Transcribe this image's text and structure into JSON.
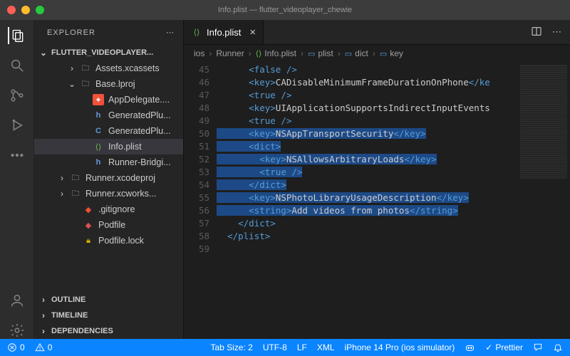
{
  "window": {
    "title": "Info.plist — flutter_videoplayer_chewie"
  },
  "sidebar": {
    "title": "EXPLORER",
    "section": "FLUTTER_VIDEOPLAYER...",
    "items": [
      {
        "indent": 48,
        "chev": "›",
        "icon": "folder",
        "label": "Assets.xcassets"
      },
      {
        "indent": 48,
        "chev": "⌄",
        "icon": "folder",
        "label": "Base.lproj"
      },
      {
        "indent": 66,
        "chev": "",
        "icon": "swift",
        "label": "AppDelegate...."
      },
      {
        "indent": 66,
        "chev": "",
        "icon": "h",
        "label": "GeneratedPlu..."
      },
      {
        "indent": 66,
        "chev": "",
        "icon": "c",
        "label": "GeneratedPlu..."
      },
      {
        "indent": 66,
        "chev": "",
        "icon": "plist",
        "label": "Info.plist",
        "active": true
      },
      {
        "indent": 66,
        "chev": "",
        "icon": "h",
        "label": "Runner-Bridgi..."
      },
      {
        "indent": 34,
        "chev": "›",
        "icon": "folder",
        "label": "Runner.xcodeproj"
      },
      {
        "indent": 34,
        "chev": "›",
        "icon": "folder",
        "label": "Runner.xcworks..."
      },
      {
        "indent": 52,
        "chev": "",
        "icon": "git",
        "label": ".gitignore"
      },
      {
        "indent": 52,
        "chev": "",
        "icon": "ruby",
        "label": "Podfile"
      },
      {
        "indent": 52,
        "chev": "",
        "icon": "lock",
        "label": "Podfile.lock"
      }
    ],
    "panels": [
      "OUTLINE",
      "TIMELINE",
      "DEPENDENCIES"
    ]
  },
  "tab": {
    "label": "Info.plist"
  },
  "breadcrumbs": [
    "ios",
    "Runner",
    "Info.plist",
    "plist",
    "dict",
    "key"
  ],
  "gutter": {
    "start": 45,
    "end": 59
  },
  "code": {
    "lines": [
      {
        "t": "      <false />"
      },
      {
        "t": "      <key>CADisableMinimumFrameDurationOnPhone</ke"
      },
      {
        "t": "      <true />"
      },
      {
        "t": "      <key>UIApplicationSupportsIndirectInputEvents"
      },
      {
        "t": "      <true />"
      },
      {
        "sel": true,
        "t": "      <key>NSAppTransportSecurity</key>"
      },
      {
        "sel": true,
        "t": "      <dict>"
      },
      {
        "sel": true,
        "t": "        <key>NSAllowsArbitraryLoads</key>"
      },
      {
        "sel": true,
        "t": "        <true />"
      },
      {
        "sel": true,
        "t": "      </dict>"
      },
      {
        "sel": true,
        "t": "      <key>NSPhotoLibraryUsageDescription</key>"
      },
      {
        "sel": true,
        "t": "      <string>Add videos from photos</string>"
      },
      {
        "t": "    </dict>"
      },
      {
        "t": "  </plist>"
      },
      {
        "t": ""
      }
    ]
  },
  "status": {
    "errors": "0",
    "warnings": "0",
    "tabsize": "Tab Size: 2",
    "encoding": "UTF-8",
    "eol": "LF",
    "lang": "XML",
    "device": "iPhone 14 Pro (ios simulator)",
    "formatter": "Prettier"
  }
}
